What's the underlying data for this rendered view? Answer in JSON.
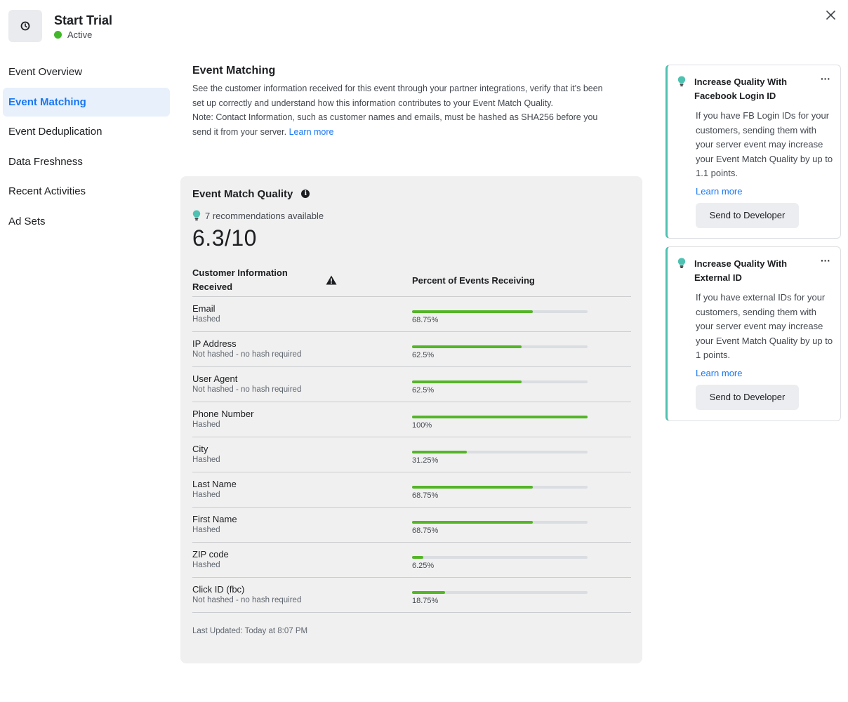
{
  "header": {
    "title": "Start Trial",
    "status": "Active",
    "icon": "clock-icon",
    "status_color": "#42b72a"
  },
  "sidebar": {
    "items": [
      {
        "label": "Event Overview",
        "active": false
      },
      {
        "label": "Event Matching",
        "active": true
      },
      {
        "label": "Event Deduplication",
        "active": false
      },
      {
        "label": "Data Freshness",
        "active": false
      },
      {
        "label": "Recent Activities",
        "active": false
      },
      {
        "label": "Ad Sets",
        "active": false
      }
    ]
  },
  "main": {
    "title": "Event Matching",
    "desc_line1": "See the customer information received for this event through your partner integrations, verify that it's been set up correctly and understand how this information contributes to your Event Match Quality.",
    "desc_note": "Note: Contact Information, such as customer names and emails, must be hashed as SHA256 before you send it from your server.",
    "learn_more": "Learn more",
    "emq": {
      "title": "Event Match Quality",
      "recommendations": "7 recommendations available",
      "score": "6.3/10",
      "col_info": "Customer Information Received",
      "col_percent": "Percent of Events Receiving",
      "rows": [
        {
          "name": "Email",
          "sub": "Hashed",
          "percent": "68.75%",
          "value": 68.75
        },
        {
          "name": "IP Address",
          "sub": "Not hashed - no hash required",
          "percent": "62.5%",
          "value": 62.5
        },
        {
          "name": "User Agent",
          "sub": "Not hashed - no hash required",
          "percent": "62.5%",
          "value": 62.5
        },
        {
          "name": "Phone Number",
          "sub": "Hashed",
          "percent": "100%",
          "value": 100
        },
        {
          "name": "City",
          "sub": "Hashed",
          "percent": "31.25%",
          "value": 31.25
        },
        {
          "name": "Last Name",
          "sub": "Hashed",
          "percent": "68.75%",
          "value": 68.75
        },
        {
          "name": "First Name",
          "sub": "Hashed",
          "percent": "68.75%",
          "value": 68.75
        },
        {
          "name": "ZIP code",
          "sub": "Hashed",
          "percent": "6.25%",
          "value": 6.25
        },
        {
          "name": "Click ID (fbc)",
          "sub": "Not hashed - no hash required",
          "percent": "18.75%",
          "value": 18.75
        }
      ],
      "updated": "Last Updated: Today at 8:07 PM"
    }
  },
  "recommendations": [
    {
      "title": "Increase Quality With Facebook Login ID",
      "body": "If you have FB Login IDs for your customers, sending them with your server event may increase your Event Match Quality by up to 1.1 points.",
      "link": "Learn more",
      "button": "Send to Developer"
    },
    {
      "title": "Increase Quality With External ID",
      "body": "If you have external IDs for your customers, sending them with your server event may increase your Event Match Quality by up to 1 points.",
      "link": "Learn more",
      "button": "Send to Developer"
    }
  ],
  "colors": {
    "accent": "#1877f2",
    "bar_fill": "#54b527",
    "card_accent": "#4ec1b1"
  }
}
